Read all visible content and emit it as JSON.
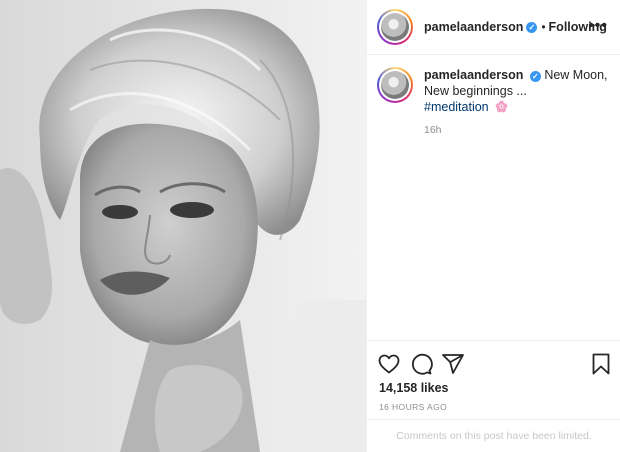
{
  "header": {
    "username": "pamelaanderson",
    "separator": "•",
    "follow_status": "Following",
    "more_label": "•••"
  },
  "caption": {
    "username": "pamelaanderson",
    "line1": "New Moon,",
    "line2": "New beginnings ...",
    "hashtag": "#meditation",
    "time_ago": "16h"
  },
  "actions": {
    "like_icon": "heart-icon",
    "comment_icon": "comment-icon",
    "share_icon": "share-icon",
    "save_icon": "bookmark-icon"
  },
  "likes": "14,158 likes",
  "posted": "16 HOURS AGO",
  "comments_notice": "Comments on this post have been limited.",
  "colors": {
    "verified": "#3897f0",
    "hashtag": "#00376b",
    "muted": "#8e8e8e",
    "notice": "#c7c7c7"
  }
}
